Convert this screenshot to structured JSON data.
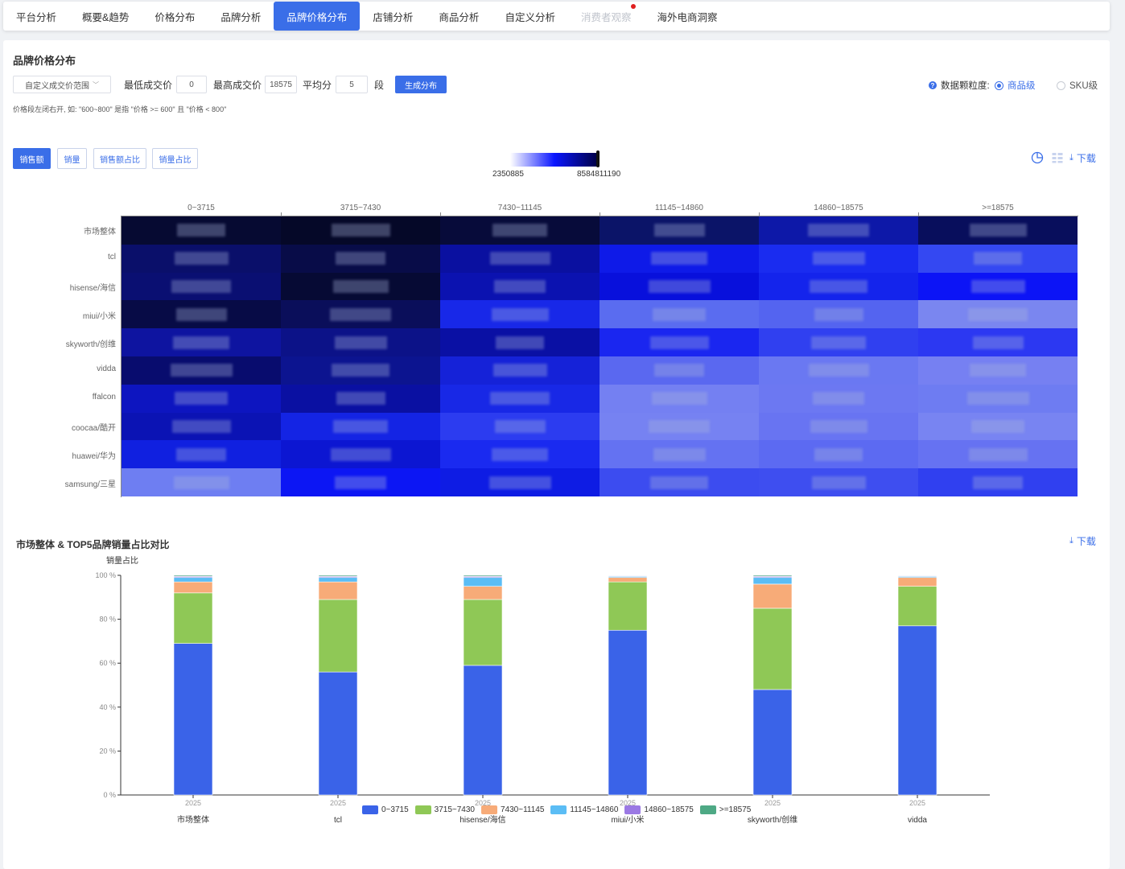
{
  "nav": {
    "tabs": [
      {
        "label": "平台分析",
        "state": "normal"
      },
      {
        "label": "概要&趋势",
        "state": "normal"
      },
      {
        "label": "价格分布",
        "state": "normal"
      },
      {
        "label": "品牌分析",
        "state": "normal"
      },
      {
        "label": "品牌价格分布",
        "state": "active"
      },
      {
        "label": "店铺分析",
        "state": "normal"
      },
      {
        "label": "商品分析",
        "state": "normal"
      },
      {
        "label": "自定义分析",
        "state": "normal"
      },
      {
        "label": "消费者观察",
        "state": "disabled"
      },
      {
        "label": "海外电商洞察",
        "state": "normal"
      }
    ]
  },
  "section1": {
    "title": "品牌价格分布",
    "range_select": "自定义成交价范围",
    "min_label": "最低成交价",
    "min_value": "0",
    "max_label": "最高成交价",
    "max_value": "18575",
    "avg_label": "平均分",
    "avg_value": "5",
    "segment_label": "段",
    "generate_btn": "生成分布",
    "note": "价格段左闭右开, 如: \"600~800\" 是指 \"价格 >= 600\" 且 \"价格 < 800\"",
    "granularity_label": "数据颗粒度:",
    "granularity_options": [
      "商品级",
      "SKU级"
    ],
    "granularity_selected": "商品级",
    "metric_tabs": [
      "销售额",
      "销量",
      "销售额占比",
      "销量占比"
    ],
    "metric_selected": "销售额",
    "legend_min": "2350885",
    "legend_max": "8584811190",
    "download": "下载"
  },
  "heatmap": {
    "columns": [
      "0~3715",
      "3715~7430",
      "7430~11145",
      "11145~14860",
      "14860~18575",
      ">=18575"
    ],
    "rows": [
      "市场整体",
      "tcl",
      "hisense/海信",
      "miui/小米",
      "skyworth/创维",
      "vidda",
      "ffalcon",
      "coocaa/酷开",
      "huawei/华为",
      "samsung/三星"
    ],
    "cell_colors": [
      [
        "#060a32",
        "#050828",
        "#070b3a",
        "#0b1468",
        "#0d18a8",
        "#080e5c"
      ],
      [
        "#0a0f6a",
        "#080c48",
        "#0a10a0",
        "#0e1ae8",
        "#1a2cf0",
        "#3448f2"
      ],
      [
        "#0a0f72",
        "#060a34",
        "#0b12b0",
        "#0810dc",
        "#1424ec",
        "#0c14f6"
      ],
      [
        "#070b46",
        "#0a0e5a",
        "#1828e8",
        "#5a6cf0",
        "#5464f0",
        "#7a86f0"
      ],
      [
        "#0e14a0",
        "#0c1288",
        "#0a10a4",
        "#1a26f0",
        "#3040f0",
        "#2c38f2"
      ],
      [
        "#080c6e",
        "#0c1490",
        "#1522d8",
        "#5a68f0",
        "#6a78f2",
        "#7680f2"
      ],
      [
        "#0d15c0",
        "#0a10a2",
        "#1828e6",
        "#7480f2",
        "#6c78f2",
        "#6e7cf2"
      ],
      [
        "#0b13b4",
        "#1424e4",
        "#2c3cf0",
        "#7682f2",
        "#6874f2",
        "#7884f2"
      ],
      [
        "#1020e0",
        "#0c16d2",
        "#1a2af0",
        "#6472f2",
        "#5c6af2",
        "#6672f2"
      ],
      [
        "#6e7ef2",
        "#0c16f4",
        "#0e1ce4",
        "#3c4cf0",
        "#3e4ef0",
        "#3040f0"
      ]
    ]
  },
  "section2": {
    "title": "市场整体 & TOP5品牌销量占比对比",
    "download": "下载"
  },
  "chart_data": {
    "type": "bar",
    "stacked": true,
    "ylabel": "销量占比",
    "ylim": [
      0,
      100
    ],
    "yticks": [
      "0 %",
      "20 %",
      "40 %",
      "60 %",
      "80 %",
      "100 %"
    ],
    "categories": [
      "市场整体",
      "tcl",
      "hisense/海信",
      "miui/小米",
      "skyworth/创维",
      "vidda"
    ],
    "year_labels": [
      "2025",
      "2025",
      "2025",
      "2025",
      "2025",
      "2025"
    ],
    "series": [
      {
        "name": "0~3715",
        "color": "#3a63e8",
        "values": [
          69,
          56,
          59,
          75,
          48,
          77
        ]
      },
      {
        "name": "3715~7430",
        "color": "#8fc856",
        "values": [
          23,
          33,
          30,
          22,
          37,
          18
        ]
      },
      {
        "name": "7430~11145",
        "color": "#f7ab78",
        "values": [
          5,
          8,
          6,
          2,
          11,
          4
        ]
      },
      {
        "name": "11145~14860",
        "color": "#5bbdf5",
        "values": [
          2,
          2,
          4,
          0.5,
          3,
          0.5
        ]
      },
      {
        "name": "14860~18575",
        "color": "#9b79e4",
        "values": [
          0.5,
          0.5,
          0.5,
          0.3,
          0.5,
          0.3
        ]
      },
      {
        "name": ">=18575",
        "color": "#4ea985",
        "values": [
          0.5,
          0.5,
          0.5,
          0.2,
          0.5,
          0.2
        ]
      }
    ]
  }
}
